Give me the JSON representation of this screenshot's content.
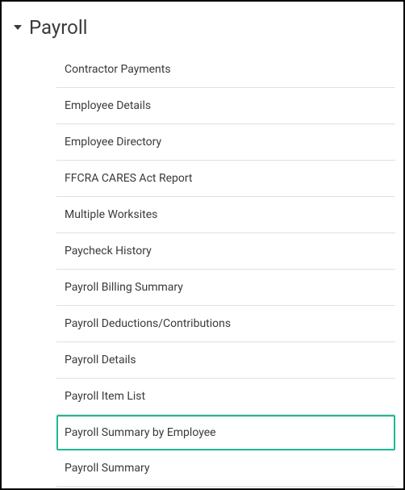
{
  "section": {
    "title": "Payroll",
    "items": [
      {
        "label": "Contractor Payments",
        "highlighted": false
      },
      {
        "label": "Employee Details",
        "highlighted": false
      },
      {
        "label": "Employee Directory",
        "highlighted": false
      },
      {
        "label": "FFCRA CARES Act Report",
        "highlighted": false
      },
      {
        "label": "Multiple Worksites",
        "highlighted": false
      },
      {
        "label": "Paycheck History",
        "highlighted": false
      },
      {
        "label": "Payroll Billing Summary",
        "highlighted": false
      },
      {
        "label": "Payroll Deductions/Contributions",
        "highlighted": false
      },
      {
        "label": "Payroll Details",
        "highlighted": false
      },
      {
        "label": "Payroll Item List",
        "highlighted": false
      },
      {
        "label": "Payroll Summary by Employee",
        "highlighted": true
      },
      {
        "label": "Payroll Summary",
        "highlighted": false
      }
    ]
  }
}
